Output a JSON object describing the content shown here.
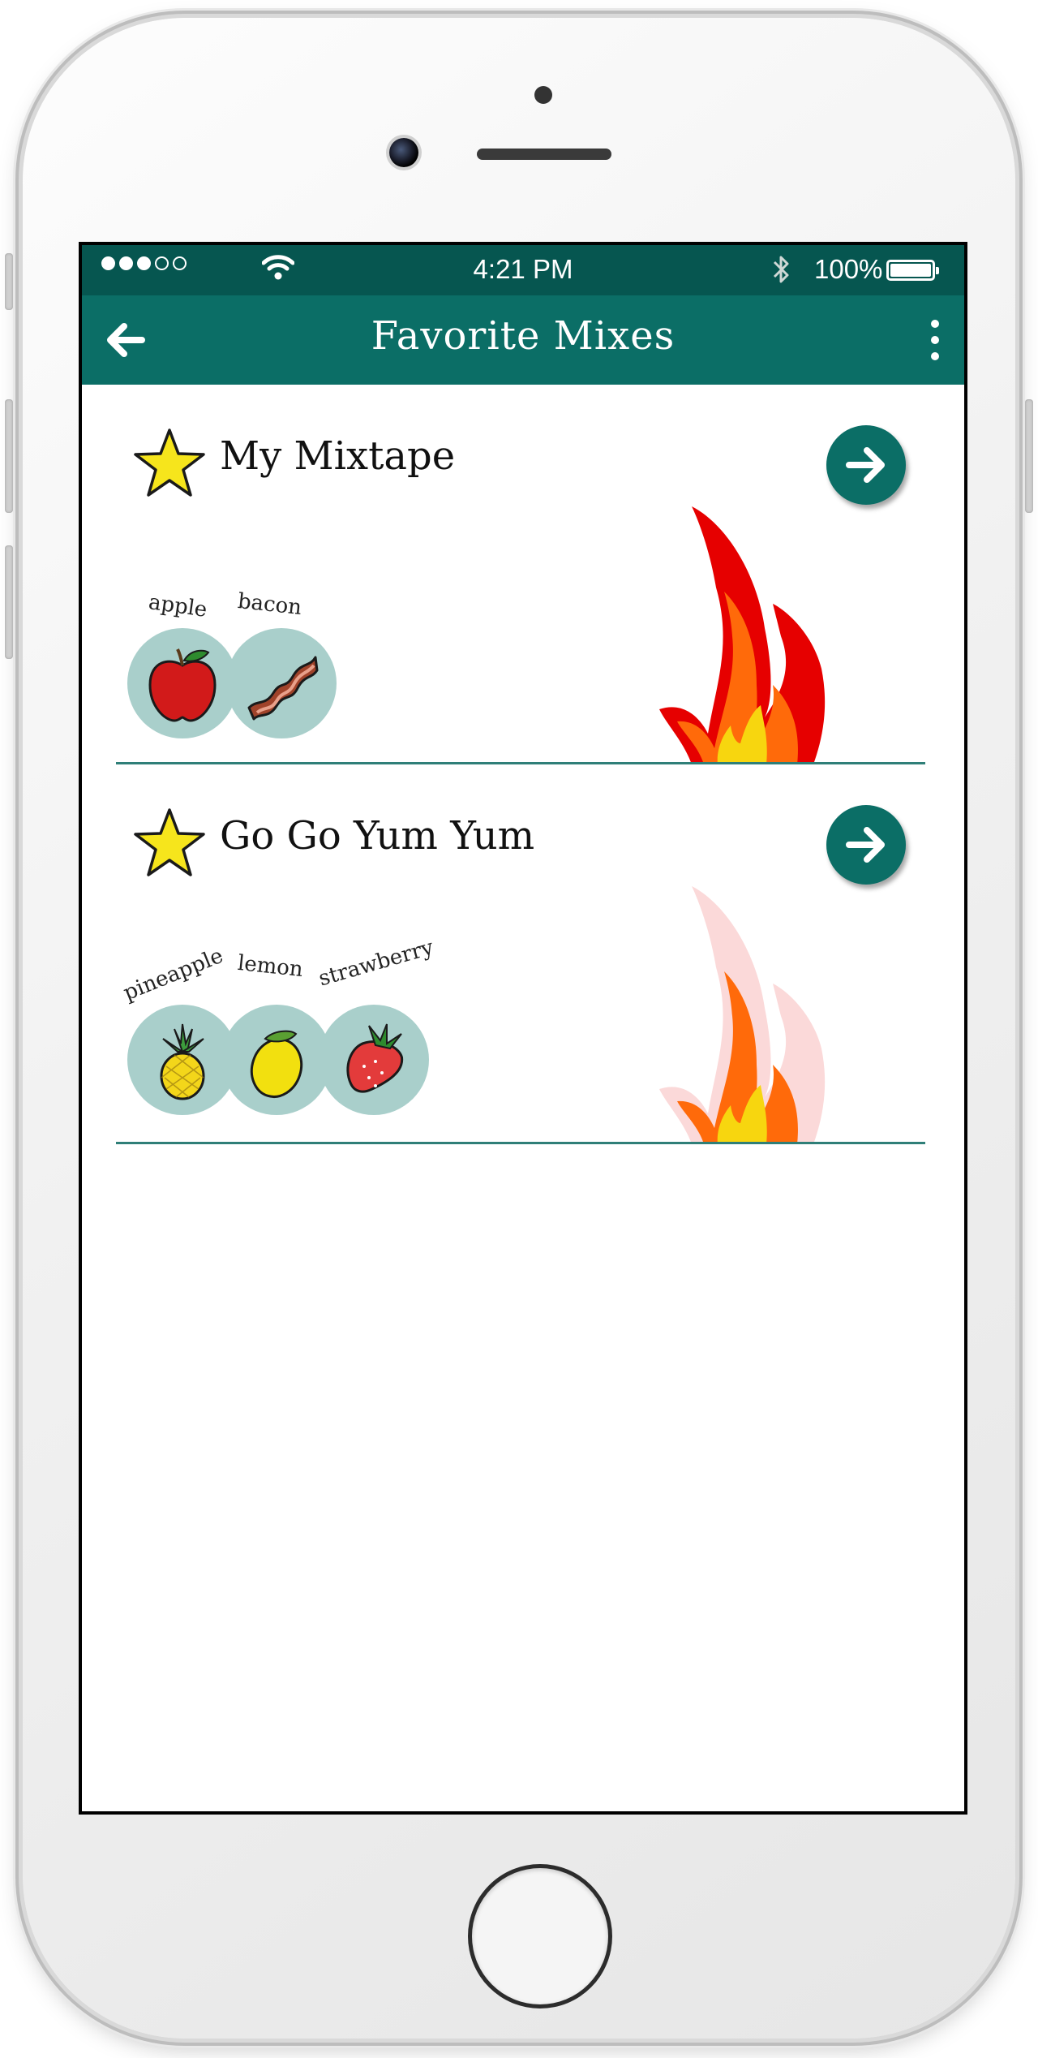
{
  "status_bar": {
    "time": "4:21 PM",
    "battery_pct": "100%"
  },
  "app_bar": {
    "title": "Favorite Mixes"
  },
  "mixes": [
    {
      "name": "My Mixtape",
      "flame_level": "full",
      "ingredients": [
        {
          "label": "apple",
          "icon": "apple-icon"
        },
        {
          "label": "bacon",
          "icon": "bacon-icon"
        }
      ]
    },
    {
      "name": "Go Go Yum Yum",
      "flame_level": "partial",
      "ingredients": [
        {
          "label": "pineapple",
          "icon": "pineapple-icon"
        },
        {
          "label": "lemon",
          "icon": "lemon-icon"
        },
        {
          "label": "strawberry",
          "icon": "strawberry-icon"
        }
      ]
    }
  ],
  "colors": {
    "accent": "#0b6e66",
    "status_bar": "#065650",
    "ingredient_bg": "#a9cfcb",
    "star": "#f6e51c"
  }
}
